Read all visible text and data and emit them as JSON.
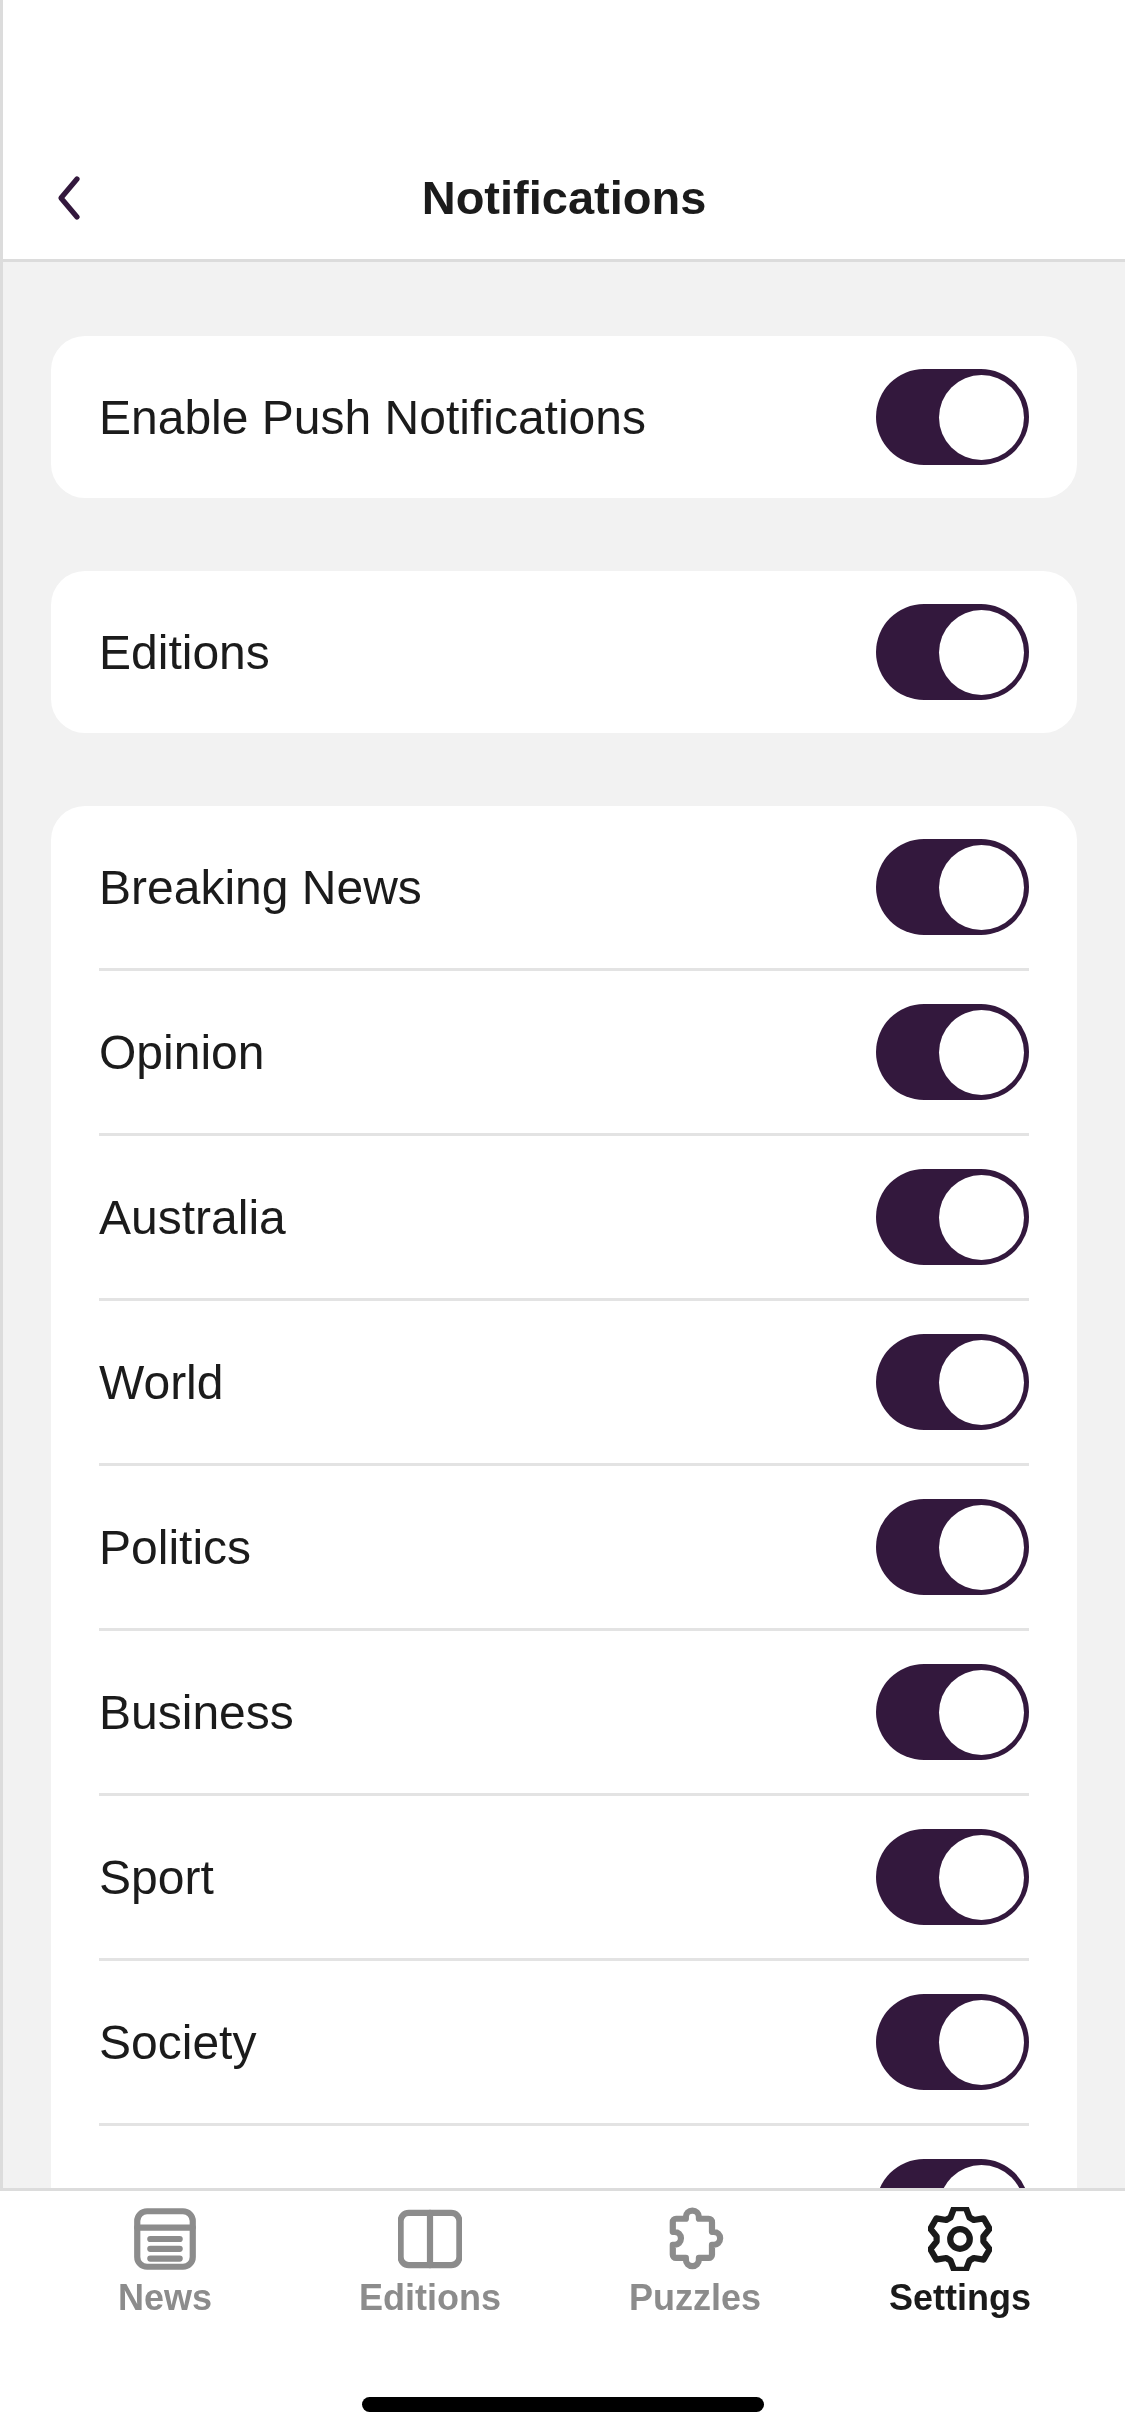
{
  "header": {
    "title": "Notifications"
  },
  "groups": [
    {
      "rows": [
        {
          "label": "Enable Push Notifications",
          "on": true
        }
      ]
    },
    {
      "rows": [
        {
          "label": "Editions",
          "on": true
        }
      ]
    },
    {
      "rows": [
        {
          "label": "Breaking News",
          "on": true
        },
        {
          "label": "Opinion",
          "on": true
        },
        {
          "label": "Australia",
          "on": true
        },
        {
          "label": "World",
          "on": true
        },
        {
          "label": "Politics",
          "on": true
        },
        {
          "label": "Business",
          "on": true
        },
        {
          "label": "Sport",
          "on": true
        },
        {
          "label": "Society",
          "on": true
        },
        {
          "on": true
        }
      ]
    }
  ],
  "tab_bar": {
    "tabs": [
      {
        "kind": "news",
        "label": "News",
        "selected": false
      },
      {
        "kind": "editions",
        "label": "Editions",
        "selected": false
      },
      {
        "kind": "puzzles",
        "label": "Puzzles",
        "selected": false
      },
      {
        "kind": "settings",
        "label": "Settings",
        "selected": true
      }
    ]
  }
}
